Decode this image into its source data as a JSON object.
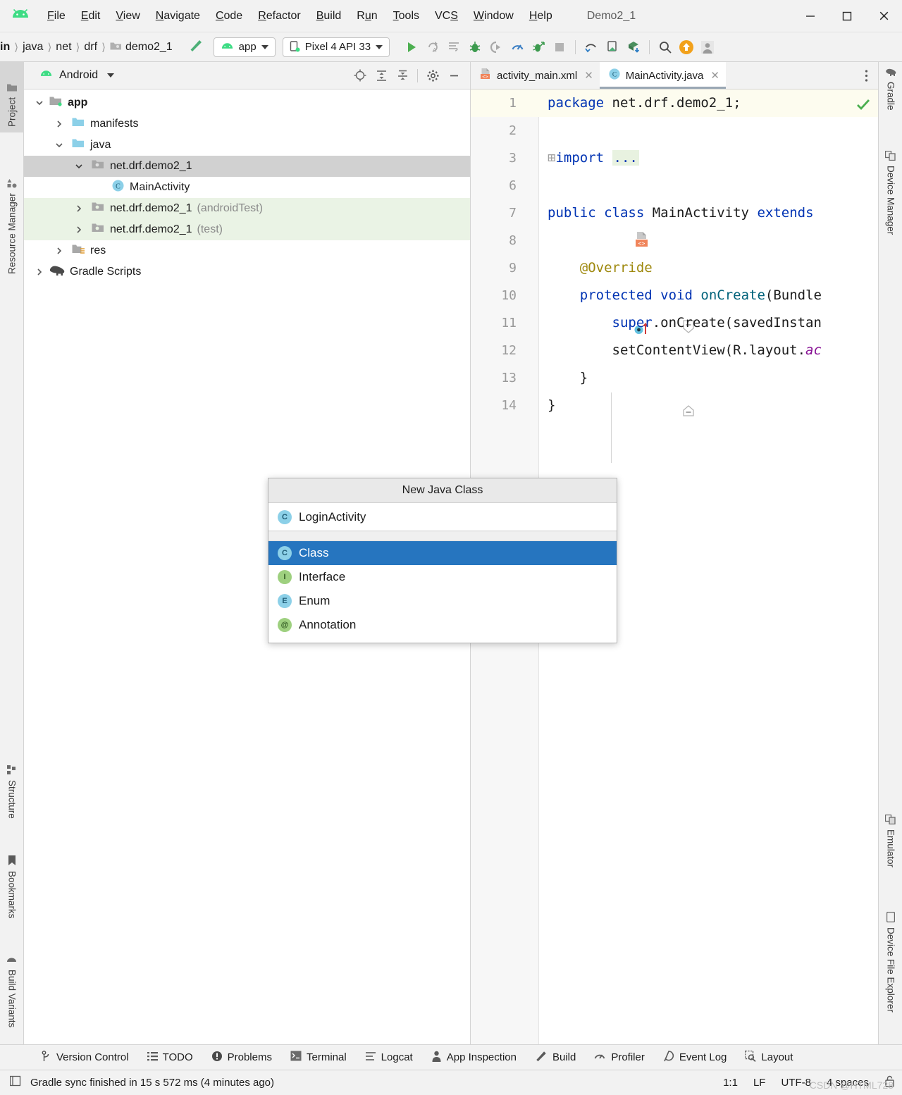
{
  "window": {
    "title": "Demo2_1",
    "minimize_label": "Minimize",
    "maximize_label": "Maximize",
    "close_label": "Close"
  },
  "menubar": {
    "logo": "android-logo-icon",
    "items": [
      {
        "label": "File",
        "mnemonic": "F"
      },
      {
        "label": "Edit",
        "mnemonic": "E"
      },
      {
        "label": "View",
        "mnemonic": "V"
      },
      {
        "label": "Navigate",
        "mnemonic": "N"
      },
      {
        "label": "Code",
        "mnemonic": "C"
      },
      {
        "label": "Refactor",
        "mnemonic": "R"
      },
      {
        "label": "Build",
        "mnemonic": "B"
      },
      {
        "label": "Run",
        "mnemonic": "u"
      },
      {
        "label": "Tools",
        "mnemonic": "T"
      },
      {
        "label": "VCS",
        "mnemonic": "S"
      },
      {
        "label": "Window",
        "mnemonic": "W"
      },
      {
        "label": "Help",
        "mnemonic": "H"
      }
    ]
  },
  "toolbar": {
    "breadcrumbs": [
      "in",
      "java",
      "net",
      "drf",
      "demo2_1"
    ],
    "build_icon": "hammer-icon",
    "run_config": "app",
    "device": "Pixel 4 API 33",
    "actions": [
      "run-icon",
      "apply-changes-icon",
      "apply-code-changes-icon",
      "debug-icon",
      "run-with-coverage-icon",
      "profiler-icon",
      "attach-debugger-icon",
      "stop-icon"
    ],
    "actions2": [
      "sdk-manager-icon",
      "avd-manager-icon",
      "sync-project-icon"
    ],
    "actions3": [
      "search-icon",
      "update-icon",
      "account-icon"
    ]
  },
  "left_strip": {
    "top": [
      {
        "label": "Project",
        "icon": "project-icon",
        "active": true
      },
      {
        "label": "Resource Manager",
        "icon": "resource-manager-icon",
        "active": false
      }
    ],
    "bottom": [
      {
        "label": "Structure",
        "icon": "structure-icon"
      },
      {
        "label": "Bookmarks",
        "icon": "bookmark-icon"
      },
      {
        "label": "Build Variants",
        "icon": "build-variants-icon"
      }
    ]
  },
  "right_strip": {
    "top": [
      {
        "label": "Gradle",
        "icon": "gradle-elephant-icon"
      },
      {
        "label": "Device Manager",
        "icon": "device-manager-icon"
      }
    ],
    "bottom": [
      {
        "label": "Emulator",
        "icon": "emulator-icon"
      },
      {
        "label": "Device File Explorer",
        "icon": "device-file-explorer-icon"
      }
    ]
  },
  "project_panel": {
    "title": "Android",
    "dropdown_icon": "chevron-down-icon",
    "header_icons": [
      "select-opened-file-icon",
      "expand-all-icon",
      "collapse-all-icon",
      "settings-gear-icon",
      "hide-panel-icon"
    ],
    "tree": [
      {
        "label": "app",
        "indent": 0,
        "arrow": "down",
        "icon": "module-folder-icon",
        "bold": true,
        "selected": false,
        "test": false,
        "suffix": ""
      },
      {
        "label": "manifests",
        "indent": 1,
        "arrow": "right",
        "icon": "folder-icon",
        "bold": false,
        "selected": false,
        "test": false,
        "suffix": ""
      },
      {
        "label": "java",
        "indent": 1,
        "arrow": "down",
        "icon": "folder-icon",
        "bold": false,
        "selected": false,
        "test": false,
        "suffix": ""
      },
      {
        "label": "net.drf.demo2_1",
        "indent": 2,
        "arrow": "down",
        "icon": "package-icon",
        "bold": false,
        "selected": true,
        "test": false,
        "suffix": ""
      },
      {
        "label": "MainActivity",
        "indent": 3,
        "arrow": "none",
        "icon": "java-class-icon",
        "bold": false,
        "selected": false,
        "test": false,
        "suffix": ""
      },
      {
        "label": "net.drf.demo2_1",
        "indent": 2,
        "arrow": "right",
        "icon": "package-icon",
        "bold": false,
        "selected": false,
        "test": true,
        "suffix": "(androidTest)"
      },
      {
        "label": "net.drf.demo2_1",
        "indent": 2,
        "arrow": "right",
        "icon": "package-icon",
        "bold": false,
        "selected": false,
        "test": true,
        "suffix": "(test)"
      },
      {
        "label": "res",
        "indent": 1,
        "arrow": "right",
        "icon": "res-folder-icon",
        "bold": false,
        "selected": false,
        "test": false,
        "suffix": ""
      },
      {
        "label": "Gradle Scripts",
        "indent": 0,
        "arrow": "right",
        "icon": "gradle-elephant-icon",
        "bold": false,
        "selected": false,
        "test": false,
        "suffix": ""
      }
    ]
  },
  "editor": {
    "tabs": [
      {
        "label": "activity_main.xml",
        "icon": "xml-layout-icon",
        "active": false
      },
      {
        "label": "MainActivity.java",
        "icon": "java-class-icon",
        "active": true
      }
    ],
    "more_icon": "more-vertical-icon",
    "inspection_status": "check-ok-icon",
    "lines": [
      {
        "num": "1",
        "gutter": "",
        "current": true,
        "html": "<span class=\"k\">package</span> net.drf.demo2_1;"
      },
      {
        "num": "2",
        "gutter": "",
        "current": false,
        "html": ""
      },
      {
        "num": "3",
        "gutter": "",
        "current": false,
        "html": "<span class=\"fold\">⊞</span><span class=\"k\">import</span> <span class=\"impdots\">...</span>"
      },
      {
        "num": "6",
        "gutter": "",
        "current": false,
        "html": ""
      },
      {
        "num": "7",
        "gutter": "layout-marker",
        "current": false,
        "html": "<span class=\"k\">public class</span> MainActivity <span class=\"k\">extends</span>"
      },
      {
        "num": "8",
        "gutter": "",
        "current": false,
        "html": ""
      },
      {
        "num": "9",
        "gutter": "",
        "current": false,
        "html": "    <span class=\"an\">@Override</span>"
      },
      {
        "num": "10",
        "gutter": "override-marker",
        "current": false,
        "html": "    <span class=\"k\">protected void</span> <span class=\"meth\">onCreate</span>(Bundle"
      },
      {
        "num": "11",
        "gutter": "",
        "current": false,
        "html": "        <span class=\"k\">super</span>.onCreate(savedInstan"
      },
      {
        "num": "12",
        "gutter": "",
        "current": false,
        "html": "        setContentView(R.layout.<span class=\"fld\">ac</span>"
      },
      {
        "num": "13",
        "gutter": "fold-end",
        "current": false,
        "html": "    }"
      },
      {
        "num": "14",
        "gutter": "",
        "current": false,
        "html": "}"
      }
    ]
  },
  "dialog": {
    "title": "New Java Class",
    "input_value": "LoginActivity",
    "input_icon": "java-class-icon",
    "items": [
      {
        "label": "Class",
        "icon": "class-icon",
        "selected": true
      },
      {
        "label": "Interface",
        "icon": "interface-icon",
        "selected": false
      },
      {
        "label": "Enum",
        "icon": "enum-icon",
        "selected": false
      },
      {
        "label": "Annotation",
        "icon": "annotation-icon",
        "selected": false
      }
    ]
  },
  "toolwindow_bar": {
    "items": [
      {
        "label": "Version Control",
        "icon": "branch-icon"
      },
      {
        "label": "TODO",
        "icon": "todo-list-icon"
      },
      {
        "label": "Problems",
        "icon": "problems-icon"
      },
      {
        "label": "Terminal",
        "icon": "terminal-icon"
      },
      {
        "label": "Logcat",
        "icon": "logcat-icon"
      },
      {
        "label": "App Inspection",
        "icon": "app-inspection-icon"
      },
      {
        "label": "Build",
        "icon": "hammer-icon"
      },
      {
        "label": "Profiler",
        "icon": "profiler-icon"
      },
      {
        "label": "Event Log",
        "icon": "event-log-icon"
      },
      {
        "label": "Layout",
        "icon": "layout-inspector-icon"
      }
    ]
  },
  "statusbar": {
    "message_icon": "status-message-icon",
    "message": "Gradle sync finished in 15 s 572 ms (4 minutes ago)",
    "caret": "1:1",
    "line_sep": "LF",
    "encoding": "UTF-8",
    "indent": "4 spaces",
    "lock_icon": "unlock-icon",
    "watermark": "CSDN @HTML728"
  },
  "colors": {
    "accent_blue": "#2675bf",
    "android_green": "#3ddc84",
    "keyword": "#0033b3",
    "annotation": "#9e880d",
    "method": "#00627a",
    "field": "#871094",
    "test_bg": "#eaf3e5",
    "selection_gray": "#d1d1d1"
  }
}
